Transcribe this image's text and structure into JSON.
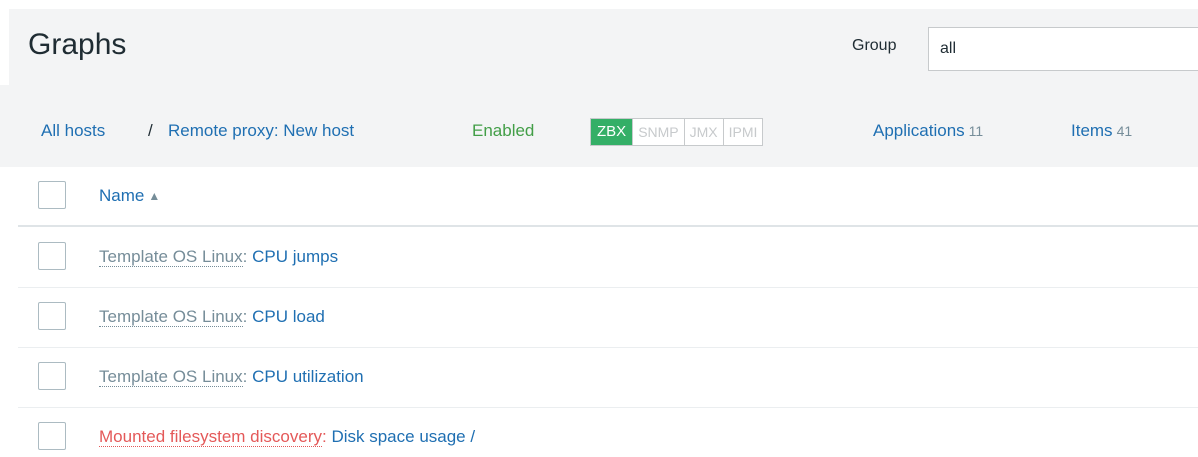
{
  "header": {
    "title": "Graphs",
    "group_label": "Group",
    "group_value": "all"
  },
  "nav": {
    "all_hosts": "All hosts",
    "separator": "/",
    "host": "Remote proxy: New host",
    "status": "Enabled",
    "availability": [
      "ZBX",
      "SNMP",
      "JMX",
      "IPMI"
    ],
    "applications_label": "Applications",
    "applications_count": "11",
    "items_label": "Items",
    "items_count": "41"
  },
  "table": {
    "column_name": "Name",
    "sort_indicator": "▲",
    "rows": [
      {
        "prefix": "Template OS Linux",
        "name": "CPU jumps"
      },
      {
        "prefix": "Template OS Linux",
        "name": "CPU load"
      },
      {
        "prefix": "Template OS Linux",
        "name": "CPU utilization"
      },
      {
        "prefix": "Mounted filesystem discovery",
        "name": "Disk space usage /"
      }
    ],
    "colon": ":"
  },
  "colors": {
    "link": "#1f6fb2",
    "enabled": "#429e47",
    "zbx_available": "#34af67",
    "discovery_prefix": "#e45959",
    "template_prefix": "#768d99"
  }
}
